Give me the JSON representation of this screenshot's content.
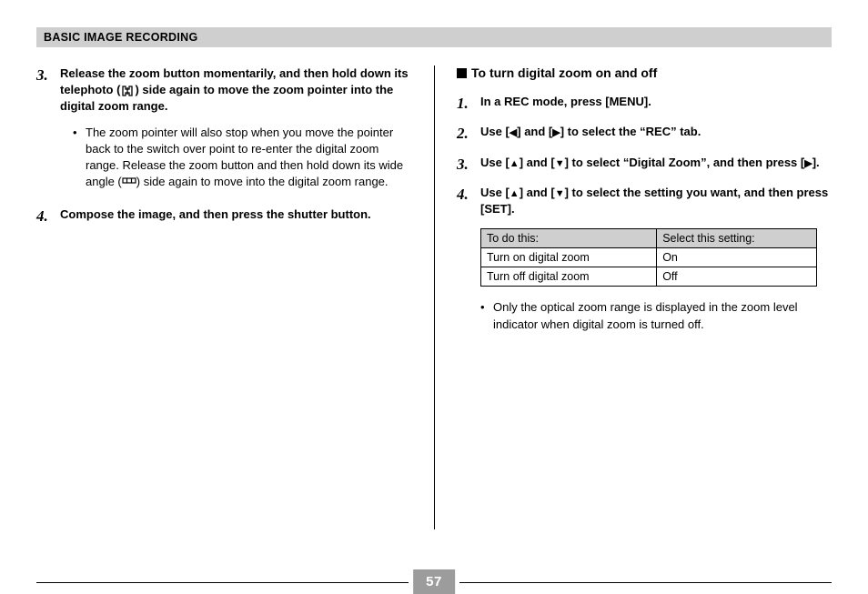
{
  "header": "BASIC IMAGE RECORDING",
  "left": {
    "step3_num": "3.",
    "step3_parts": {
      "a": "Release the zoom button momentarily, and then hold down its telephoto (",
      "b": ") side again to move the zoom pointer into the digital zoom range."
    },
    "bullet_parts": {
      "a": "The zoom pointer will also stop when you move the pointer back to the switch over point to re-enter the digital zoom range. Release the zoom button and then hold down its wide angle (",
      "b": ") side again to move into the digital zoom range."
    },
    "step4_num": "4.",
    "step4_text": "Compose the image, and then press the shutter button."
  },
  "right": {
    "heading": "To turn digital zoom on and off",
    "s1_num": "1.",
    "s1_text": "In a REC mode, press [MENU].",
    "s2_num": "2.",
    "s2_a": "Use [",
    "s2_b": "] and [",
    "s2_c": "] to select the “REC” tab.",
    "s3_num": "3.",
    "s3_a": "Use [",
    "s3_b": "] and [",
    "s3_c": "] to select “Digital Zoom”, and then press [",
    "s3_d": "].",
    "s4_num": "4.",
    "s4_a": "Use [",
    "s4_b": "] and [",
    "s4_c": "] to select the setting you want, and then press [SET].",
    "table": {
      "h1": "To do this:",
      "h2": "Select this setting:",
      "r1c1": "Turn on digital zoom",
      "r1c2": "On",
      "r2c1": "Turn off digital zoom",
      "r2c2": "Off"
    },
    "post_bullet": "Only the optical zoom range is displayed in the zoom level indicator when digital zoom is turned off."
  },
  "page_number": "57",
  "arrows": {
    "left": "◀",
    "right": "▶",
    "up": "▲",
    "down": "▼"
  }
}
